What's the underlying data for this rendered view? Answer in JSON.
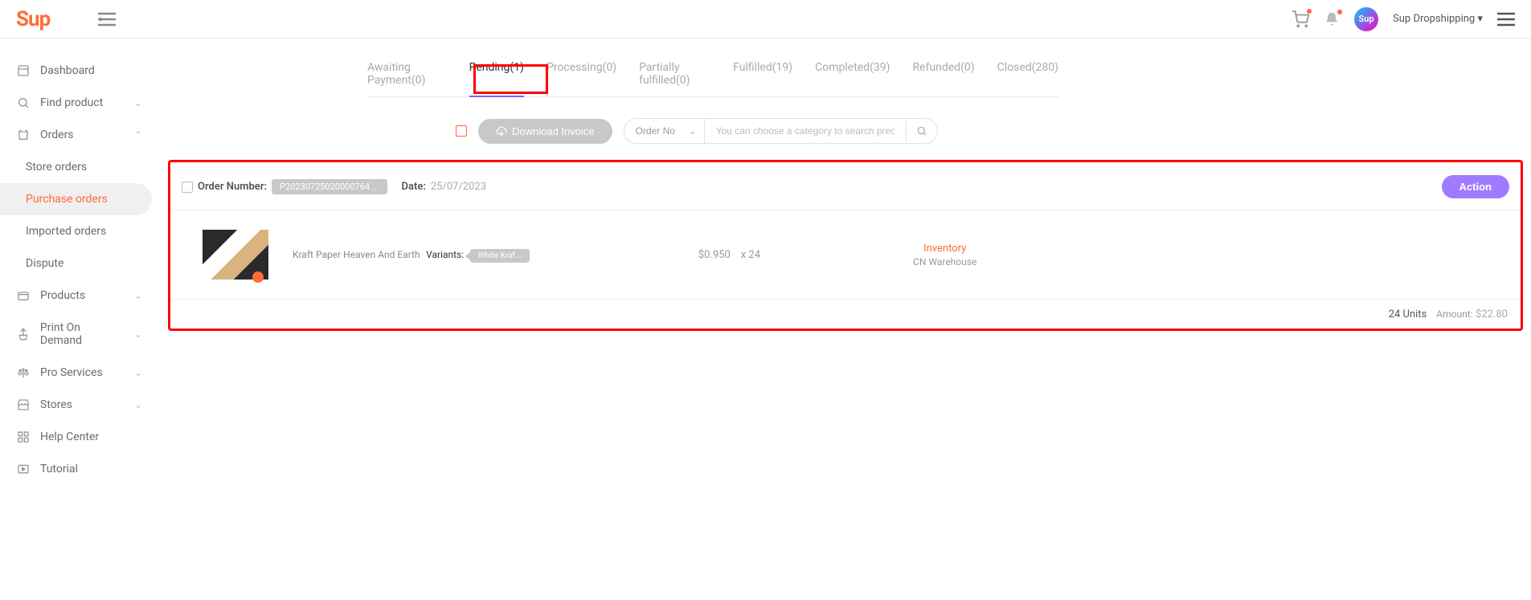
{
  "brand": "Sup",
  "user_name": "Sup Dropshipping",
  "avatar_text": "Sup",
  "sidebar": {
    "items": [
      {
        "label": "Dashboard"
      },
      {
        "label": "Find product"
      },
      {
        "label": "Orders"
      },
      {
        "label": "Store orders"
      },
      {
        "label": "Purchase orders"
      },
      {
        "label": "Imported orders"
      },
      {
        "label": "Dispute"
      },
      {
        "label": "Products"
      },
      {
        "label": "Print On Demand"
      },
      {
        "label": "Pro Services"
      },
      {
        "label": "Stores"
      },
      {
        "label": "Help Center"
      },
      {
        "label": "Tutorial"
      }
    ]
  },
  "tabs": [
    {
      "label": "Awaiting Payment(0)"
    },
    {
      "label": "Pending(1)"
    },
    {
      "label": "Processing(0)"
    },
    {
      "label": "Partially fulfilled(0)"
    },
    {
      "label": "Fulfilled(19)"
    },
    {
      "label": "Completed(39)"
    },
    {
      "label": "Refunded(0)"
    },
    {
      "label": "Closed(280)"
    }
  ],
  "toolbar": {
    "download_label": "Download Invoice",
    "search_category": "Order No",
    "search_placeholder": "You can choose a category to search precisely"
  },
  "order": {
    "number_label": "Order Number:",
    "number_value": "P20230725020000764 ...",
    "date_label": "Date:",
    "date_value": "25/07/2023",
    "action_label": "Action",
    "product_name": "Kraft Paper Heaven And Earth",
    "variants_label": "Variants:",
    "variant_value": "White Kraf...",
    "unit_price": "$0.950",
    "qty": "x 24",
    "inventory_label": "Inventory",
    "warehouse": "CN Warehouse",
    "units_text": "24 Units",
    "amount_label": "Amount:",
    "amount_value": "$22.80"
  }
}
